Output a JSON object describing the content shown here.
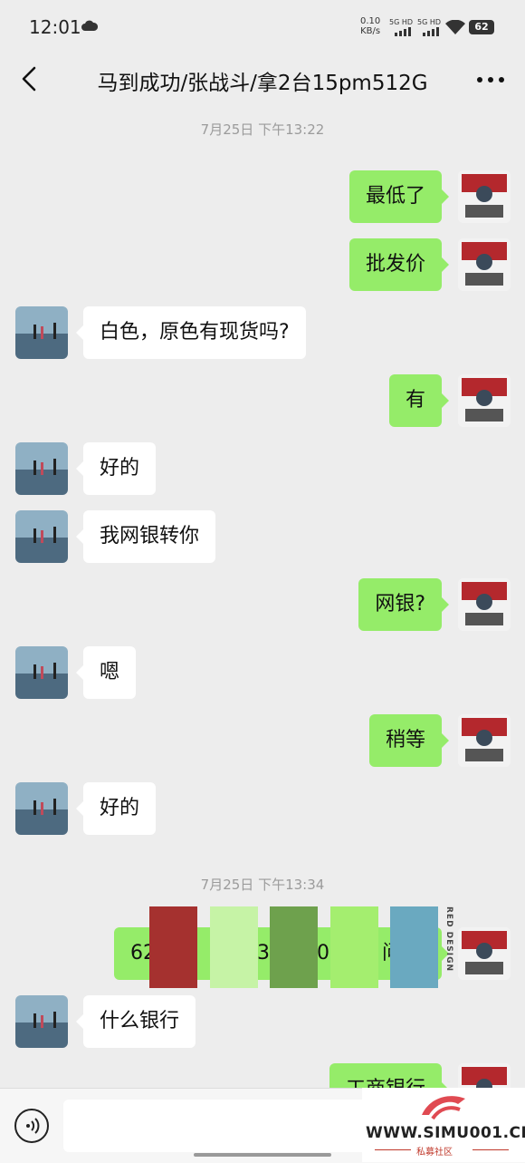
{
  "status_bar": {
    "time": "12:01",
    "net_speed_value": "0.10",
    "net_speed_unit": "KB/s",
    "sim1": "5G HD",
    "sim2": "5G HD",
    "battery": "62"
  },
  "header": {
    "title": "马到成功/张战斗/拿2台15pm512G",
    "back_icon": "chevron-left-icon",
    "more_icon": "more-dots-icon"
  },
  "chat": {
    "timestamp_1": "7月25日 下午13:22",
    "timestamp_2": "7月25日 下午13:34",
    "messages": [
      {
        "side": "out",
        "text": "最低了"
      },
      {
        "side": "out",
        "text": "批发价"
      },
      {
        "side": "in",
        "text": "白色，原色有现货吗?"
      },
      {
        "side": "out",
        "text": "有"
      },
      {
        "side": "in",
        "text": "好的"
      },
      {
        "side": "in",
        "text": "我网银转你"
      },
      {
        "side": "out",
        "text": "网银?"
      },
      {
        "side": "in",
        "text": "嗯"
      },
      {
        "side": "out",
        "text": "稍等"
      },
      {
        "side": "in",
        "text": "好的"
      },
      {
        "side": "out",
        "text": "62"
      },
      {
        "side": "in",
        "text": "什么银行"
      },
      {
        "side": "out",
        "text": "工商银行"
      }
    ],
    "obscured_fragments": [
      "3",
      "30",
      "0",
      "问"
    ],
    "overlay_label": "RED DESIGN"
  },
  "overlay_colors": [
    "#a5312f",
    "#c6f3a6",
    "#6ea14d",
    "#a4ee6f",
    "#6aa9c0"
  ],
  "input_bar": {
    "voice_icon": "voice-icon"
  },
  "watermark": {
    "site": "WWW.SIMU001.CN",
    "subtitle": "私募社区"
  },
  "colors": {
    "background": "#ededed",
    "outgoing_bubble": "#95ec69",
    "incoming_bubble": "#ffffff"
  }
}
